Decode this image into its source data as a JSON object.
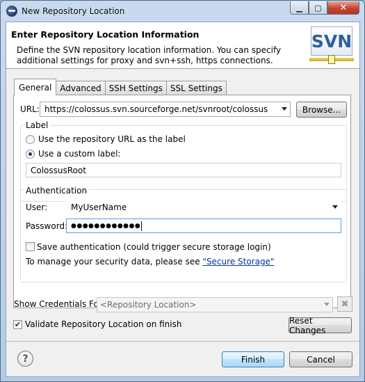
{
  "window": {
    "title": "New Repository Location"
  },
  "header": {
    "title": "Enter Repository Location Information",
    "description_line1": "Define the SVN repository location information. You can specify",
    "description_line2": "additional settings for proxy and svn+ssh, https connections.",
    "logo_text": "SVN"
  },
  "tabs": [
    {
      "label": "General",
      "active": true
    },
    {
      "label": "Advanced",
      "active": false
    },
    {
      "label": "SSH Settings",
      "active": false
    },
    {
      "label": "SSL Settings",
      "active": false
    }
  ],
  "url": {
    "label": "URL:",
    "value": "https://colossus.svn.sourceforge.net/svnroot/colossus",
    "browse_label": "Browse..."
  },
  "label_group": {
    "legend": "Label",
    "option_repo_url": "Use the repository URL as the label",
    "option_custom": "Use a custom label:",
    "selected": "custom",
    "custom_value": "ColossusRoot"
  },
  "auth_group": {
    "legend": "Authentication",
    "user_label": "User:",
    "user_value": "MyUserName",
    "password_label": "Password:",
    "password_mask": "●●●●●●●●●●●●",
    "save_auth_label": "Save authentication (could trigger secure storage login)",
    "save_auth_checked": false,
    "secure_note": "To manage your security data, please see ",
    "secure_link": "\"Secure Storage\""
  },
  "credentials": {
    "label": "Show Credentials For:",
    "value": "<Repository Location>"
  },
  "validate": {
    "label": "Validate Repository Location on finish",
    "checked": true
  },
  "buttons": {
    "reset": "Reset Changes",
    "finish": "Finish",
    "cancel": "Cancel",
    "help": "?"
  },
  "window_controls": {
    "minimize": "▁",
    "maximize": "▢",
    "close": "✕"
  }
}
